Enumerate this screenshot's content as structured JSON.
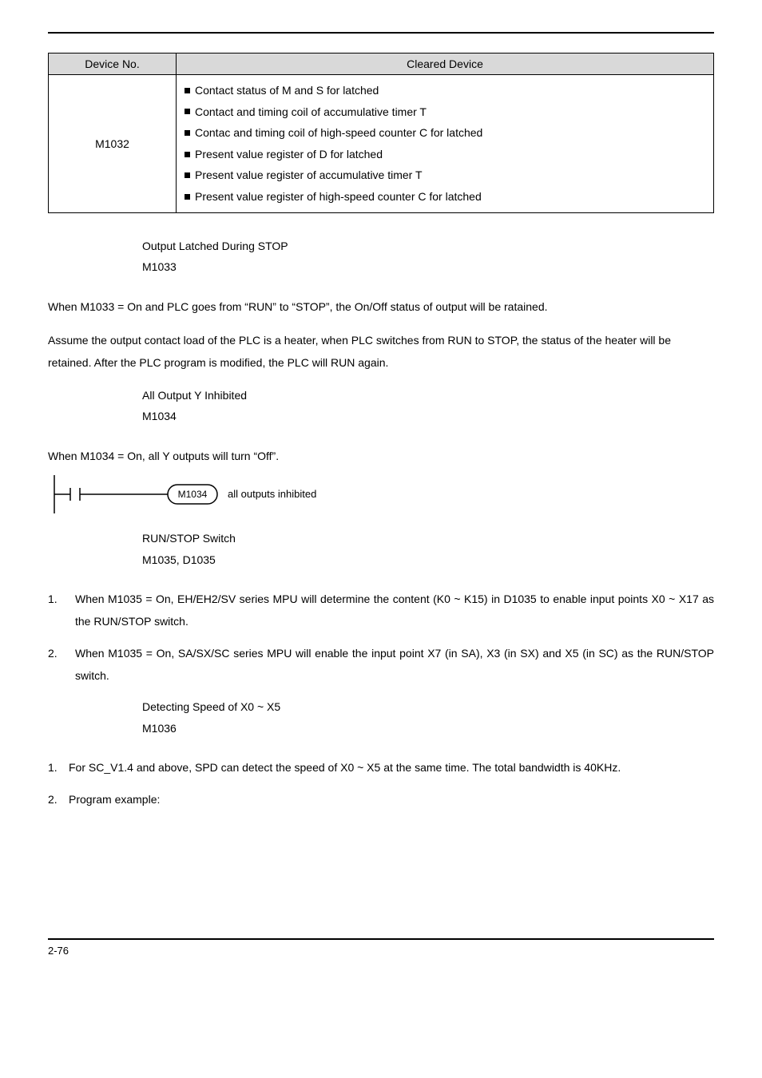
{
  "table": {
    "headers": {
      "dev": "Device No.",
      "cleared": "Cleared Device"
    },
    "device": "M1032",
    "lines": [
      "Contact status of M and S for latched",
      "Contact and timing coil of accumulative timer T",
      "Contac and timing coil of high-speed counter C for latched",
      "Present value register of D for latched",
      "Present value register of accumulative timer T",
      "Present value register of high-speed counter C for latched"
    ]
  },
  "sect1": {
    "title": "Output Latched During STOP",
    "flag": "M1033",
    "para1": "When M1033 = On and PLC goes from “RUN” to “STOP”, the On/Off status of output will be ratained.",
    "para2": "Assume the output contact load of the PLC is a heater, when PLC switches from RUN to STOP, the status of the heater will be retained. After the PLC program is modified, the PLC will RUN again."
  },
  "sect2": {
    "title": "All Output Y Inhibited",
    "flag": "M1034",
    "para": "When M1034 = On, all Y outputs will turn “Off”.",
    "ladder_coil": "M1034",
    "ladder_text": "all outputs inhibited"
  },
  "sect3": {
    "title": "RUN/STOP Switch",
    "flag": "M1035, D1035",
    "item1": "When M1035 = On, EH/EH2/SV series MPU will determine the content (K0 ~ K15) in D1035 to enable input points X0 ~ X17 as the RUN/STOP switch.",
    "item2": "When M1035 = On, SA/SX/SC series MPU will enable the input point X7 (in SA), X3 (in SX) and X5 (in SC) as the RUN/STOP switch."
  },
  "sect4": {
    "title": "Detecting Speed of X0 ~ X5",
    "flag": "M1036",
    "item1": "For SC_V1.4 and above, SPD can detect the speed of X0 ~ X5 at the same time. The total bandwidth is 40KHz.",
    "item2": "Program example:"
  },
  "footer": {
    "page": "2-76"
  },
  "nums": {
    "one": "1.",
    "two": "2."
  }
}
